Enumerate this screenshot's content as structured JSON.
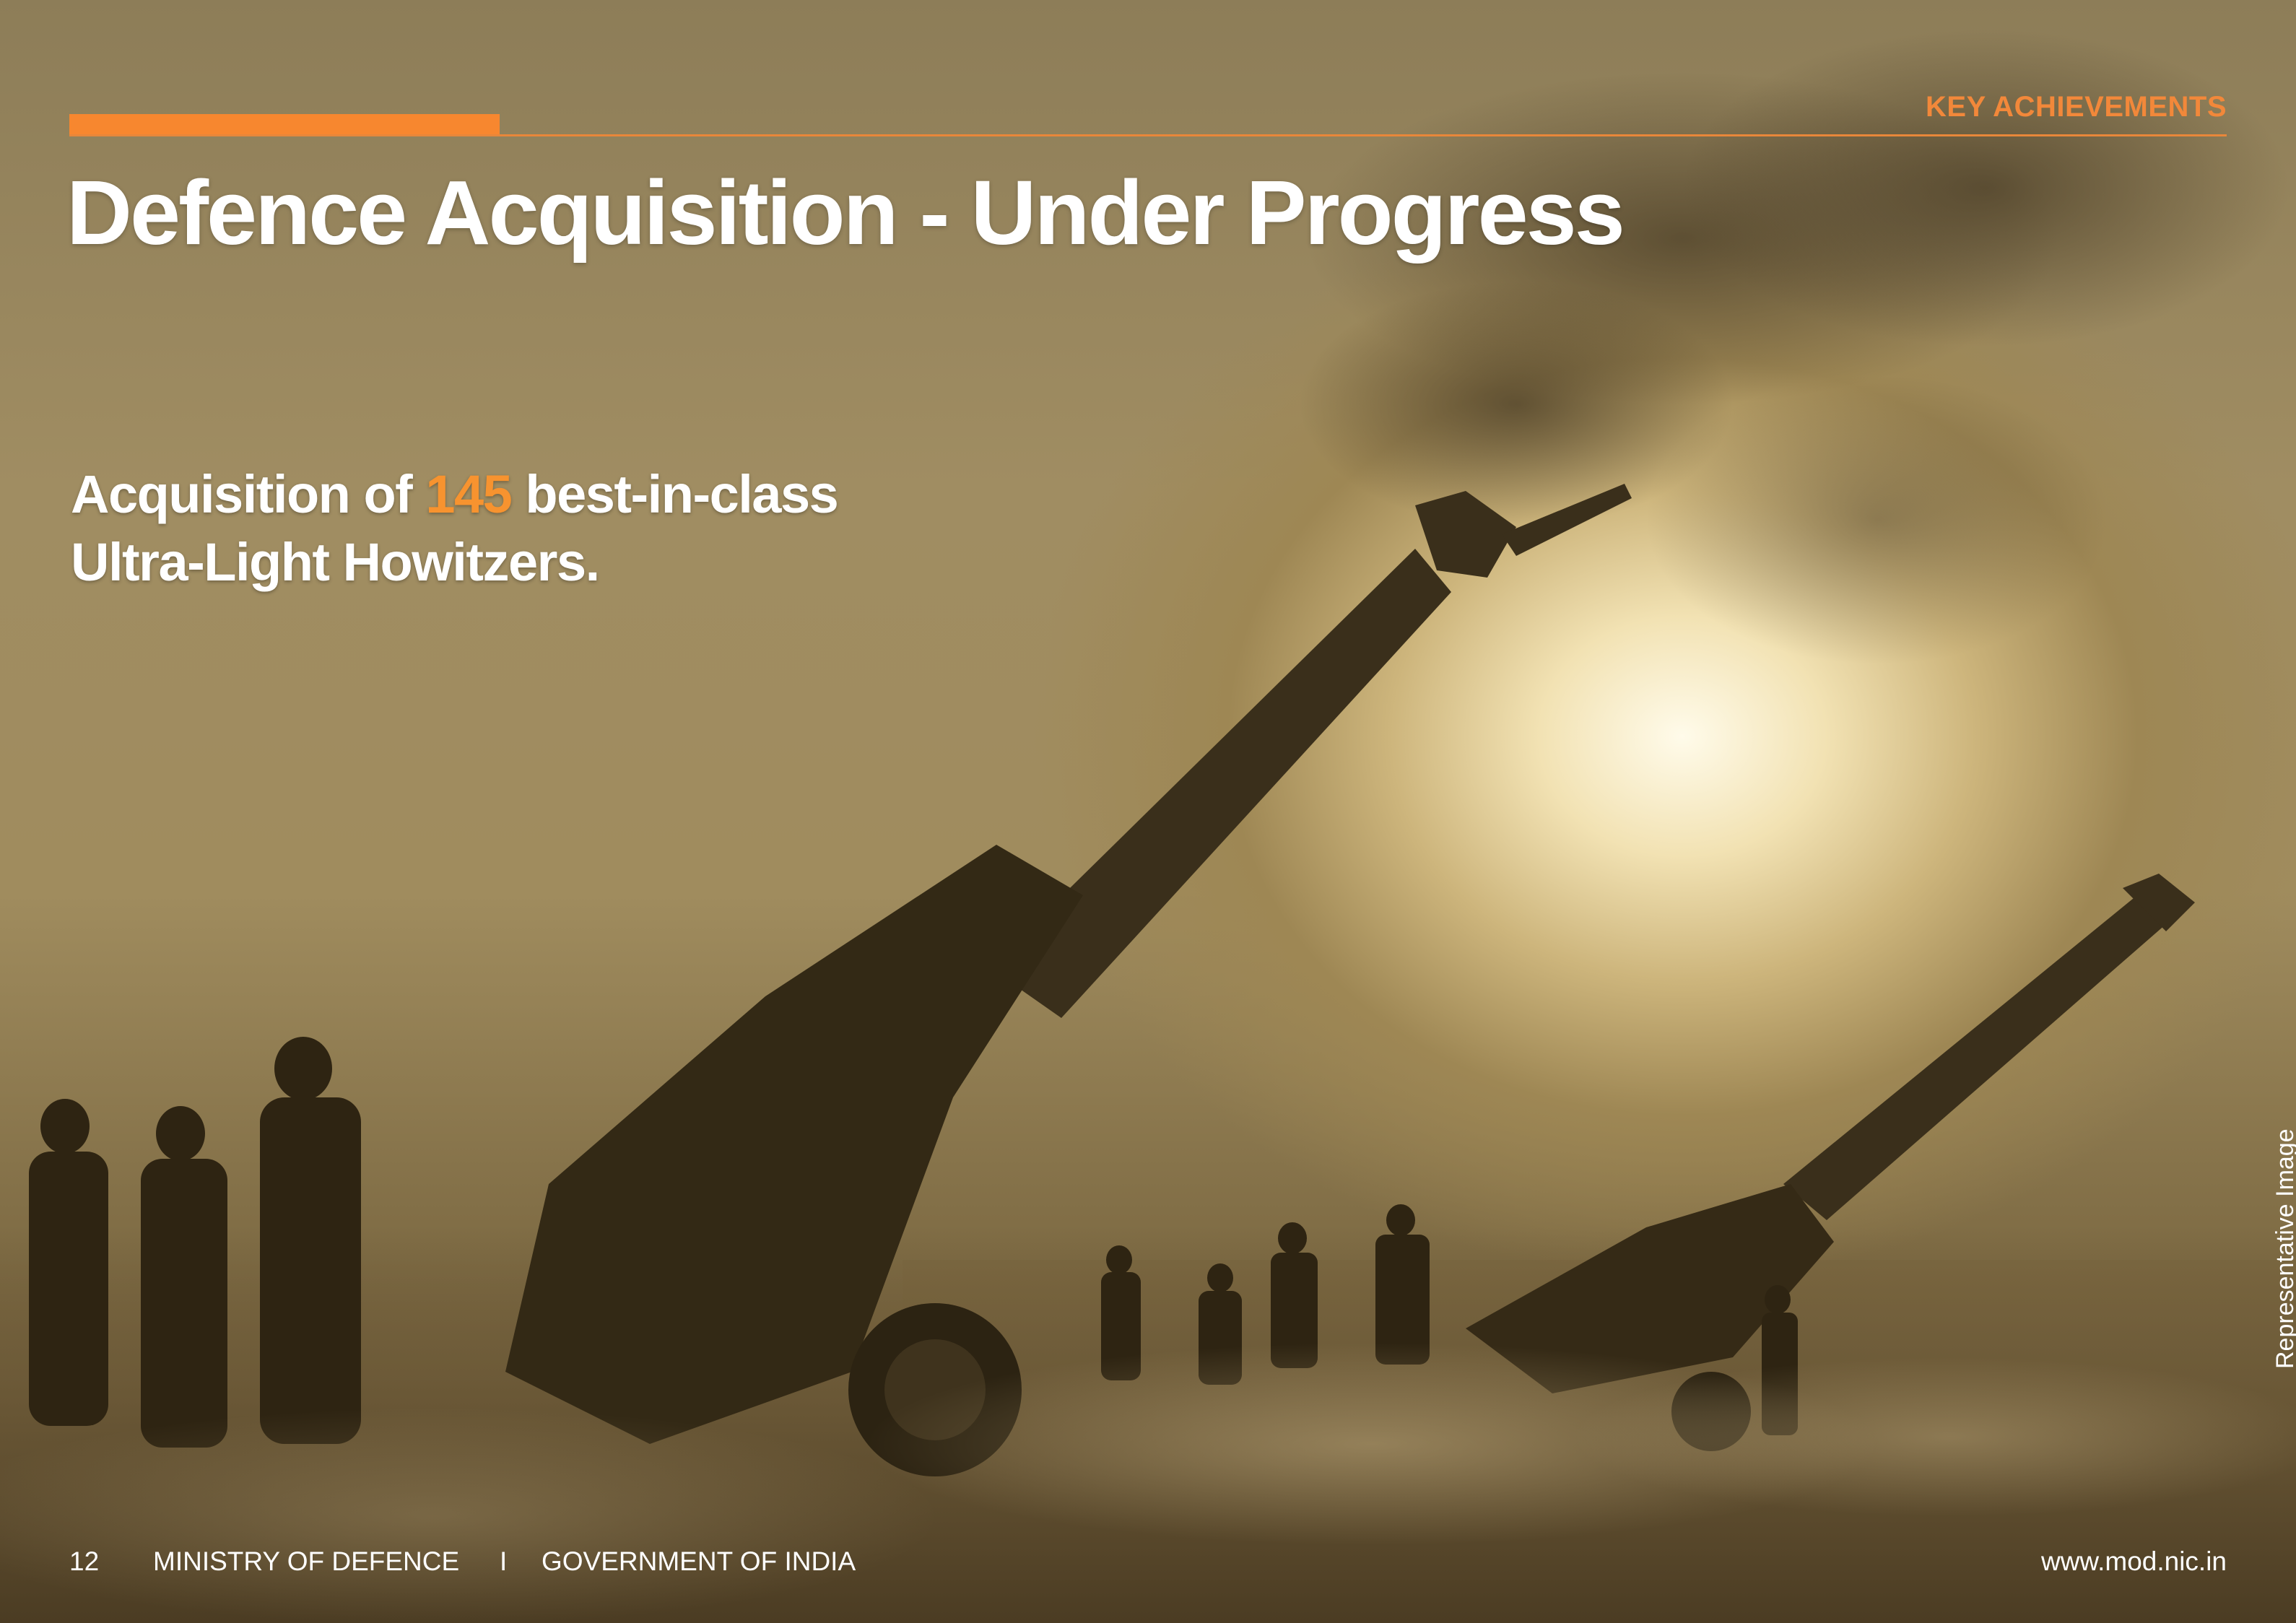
{
  "header": {
    "section_label": "KEY ACHIEVEMENTS",
    "title": "Defence Acquisition - Under Progress"
  },
  "headline": {
    "prefix": "Acquisition of ",
    "number": "145",
    "suffix_line1": " best-in-class",
    "line2": "Ultra-Light Howitzers."
  },
  "caption": {
    "representative_image": "Representative Image"
  },
  "footer": {
    "page_number": "12",
    "ministry": "MINISTRY OF DEFENCE",
    "separator": "I",
    "government": "GOVERNMENT OF INDIA",
    "website": "www.mod.nic.in"
  },
  "colors": {
    "accent_orange": "#f7872f",
    "number_orange": "#f7932f",
    "text_white": "#ffffff"
  }
}
